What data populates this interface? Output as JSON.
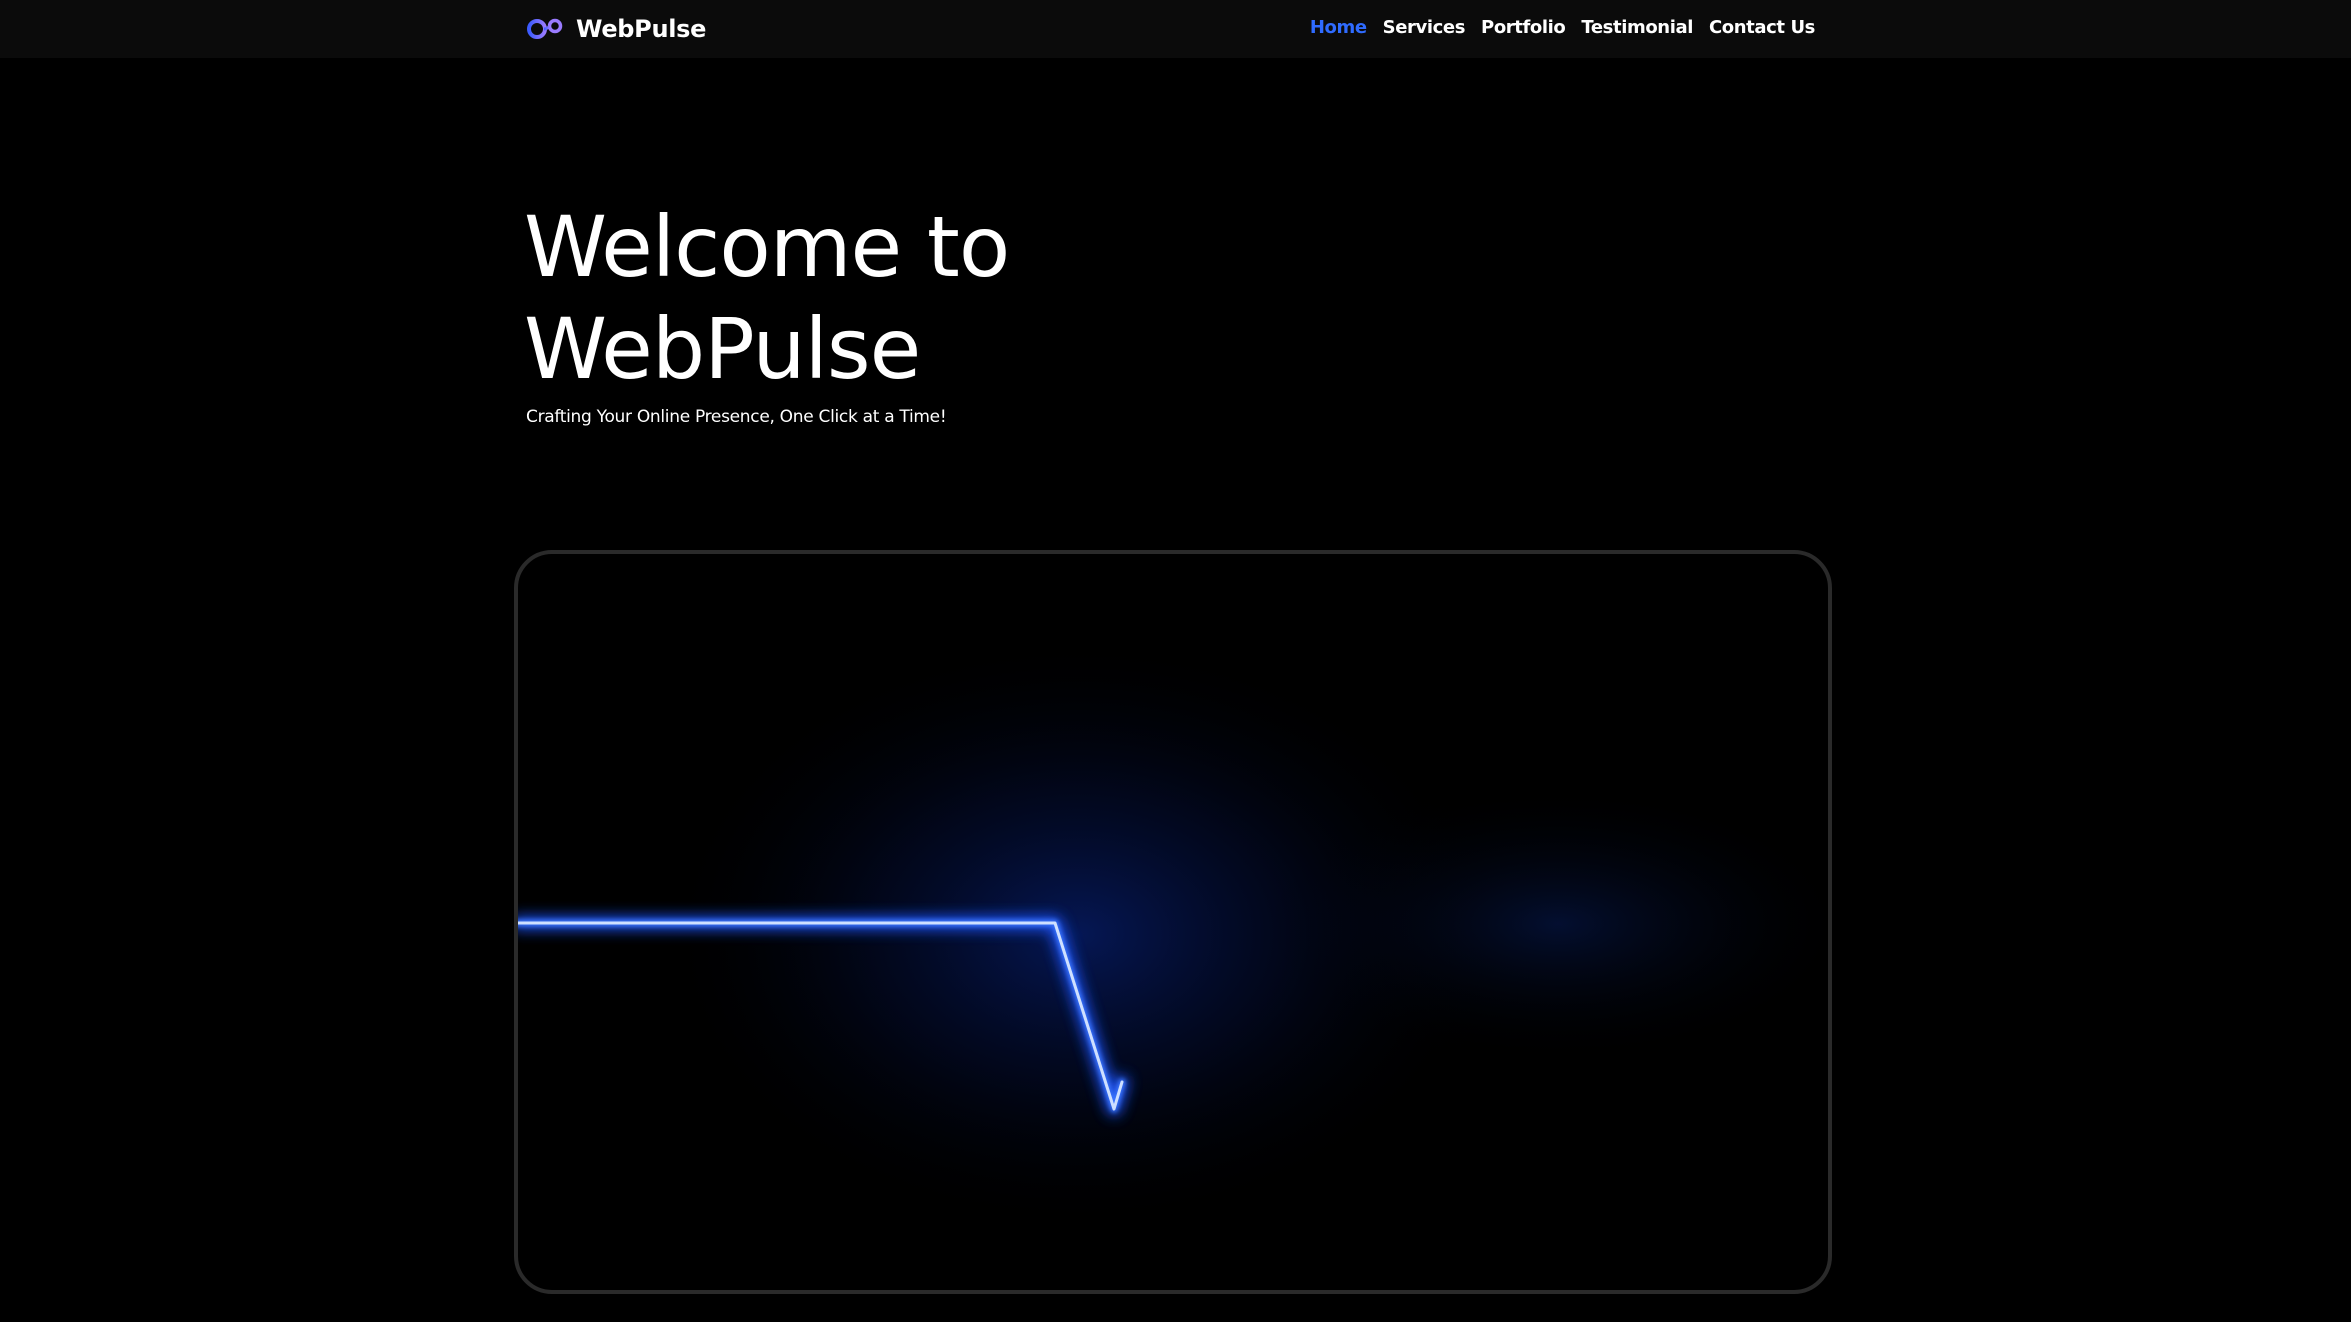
{
  "brand": {
    "name": "WebPulse",
    "logo_icon": "infinity-logo-icon",
    "logo_colors": [
      "#3b5bff",
      "#8a6bff"
    ]
  },
  "nav": {
    "items": [
      {
        "label": "Home",
        "active": true
      },
      {
        "label": "Services",
        "active": false
      },
      {
        "label": "Portfolio",
        "active": false
      },
      {
        "label": "Testimonial",
        "active": false
      },
      {
        "label": "Contact Us",
        "active": false
      }
    ],
    "active_color": "#2f6bff"
  },
  "hero": {
    "title_line_1": "Welcome to",
    "title_line_2": "WebPulse",
    "subtitle": "Crafting Your Online Presence, One Click at a Time!"
  },
  "pulse_visual": {
    "icon": "heartbeat-line-graphic",
    "line_color": "#2f6bff",
    "glow_color": "#0a3cff"
  }
}
